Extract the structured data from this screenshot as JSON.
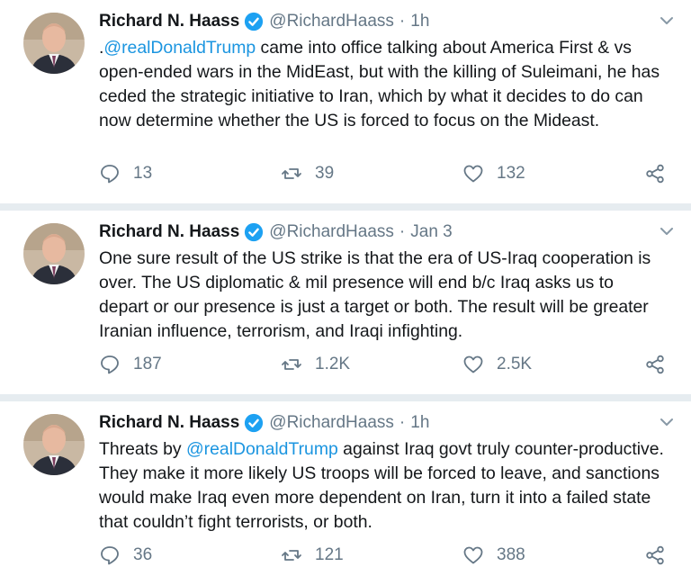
{
  "tweets": [
    {
      "name": "Richard N. Haass",
      "handle": "@RichardHaass",
      "separator": "·",
      "time": "1h",
      "text_parts": [
        ".",
        "@realDonaldTrump",
        " came into office talking about America First & vs open-ended wars in the MidEast, but with the killing of Suleimani, he has ceded the strategic initiative to Iran, which by what it decides to do can now determine whether the US is forced to focus on the Mideast."
      ],
      "replies": "13",
      "retweets": "39",
      "likes": "132"
    },
    {
      "name": "Richard N. Haass",
      "handle": "@RichardHaass",
      "separator": "·",
      "time": "Jan 3",
      "text_parts": [
        "One sure result of the US strike is that the era of US-Iraq cooperation is over. The US diplomatic &  mil presence will end b/c Iraq asks us to depart or our presence is just a target or both. The result will be greater Iranian influence, terrorism, and Iraqi infighting."
      ],
      "replies": "187",
      "retweets": "1.2K",
      "likes": "2.5K"
    },
    {
      "name": "Richard N. Haass",
      "handle": "@RichardHaass",
      "separator": "·",
      "time": "1h",
      "text_parts": [
        "Threats by ",
        "@realDonaldTrump",
        " against Iraq govt truly counter-productive. They make it more likely US troops will be forced to leave, and sanctions would make Iraq even more dependent on Iran, turn it into a failed state that couldn’t fight terrorists, or both."
      ],
      "replies": "36",
      "retweets": "121",
      "likes": "388"
    }
  ],
  "icons": {
    "verified": "verified-badge-icon",
    "caret": "chevron-down-icon",
    "reply": "reply-icon",
    "retweet": "retweet-icon",
    "like": "heart-icon",
    "share": "share-icon"
  },
  "colors": {
    "link": "#1b95e0",
    "muted": "#657786",
    "verified": "#1da1f2",
    "background": "#e6ecf0"
  }
}
